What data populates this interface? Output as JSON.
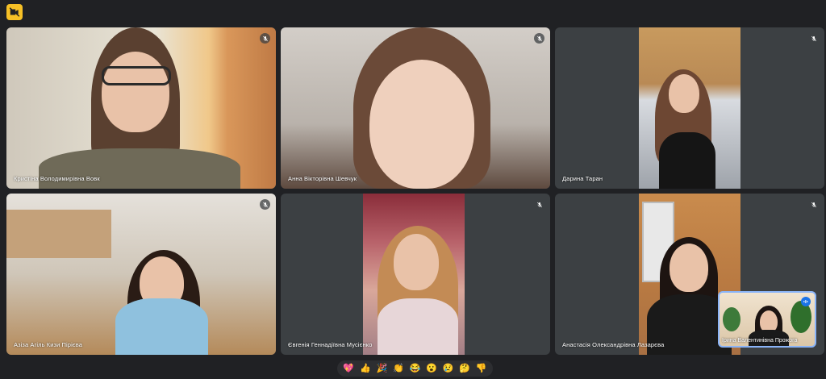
{
  "app": {
    "icon": "video-camera-off-icon",
    "accent": "#f6c026"
  },
  "participants": [
    {
      "name": "Кристіна Володимирівна Вовк",
      "mic_icon": "mic-off-icon"
    },
    {
      "name": "Анна Вікторівна Шевчук",
      "mic_icon": "mic-off-icon"
    },
    {
      "name": "Дарина Таран",
      "mic_icon": "mic-off-icon"
    },
    {
      "name": "Азіза Агіль Кизи Пірієва",
      "mic_icon": "mic-off-icon"
    },
    {
      "name": "Євгенія Геннадіївна Мусієнко",
      "mic_icon": "mic-off-icon"
    },
    {
      "name": "Анастасія Олександрівна Лазарєва",
      "mic_icon": "mic-off-icon"
    }
  ],
  "self_view": {
    "name": "Ірина Валентинівна Прожога",
    "status_icon": "speaking-icon"
  },
  "reactions": [
    "💖",
    "👍",
    "🎉",
    "👏",
    "😂",
    "😮",
    "😢",
    "🤔",
    "👎"
  ]
}
